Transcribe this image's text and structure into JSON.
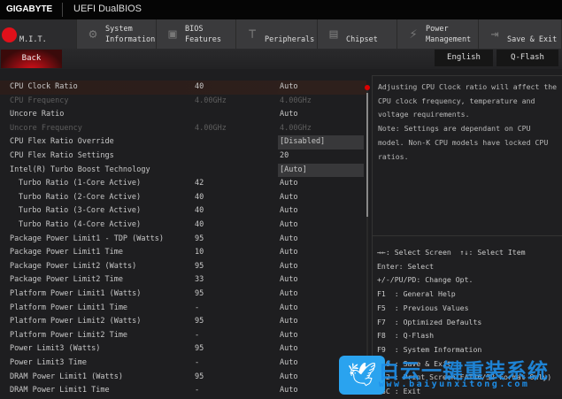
{
  "header": {
    "brand": "GIGABYTE",
    "title": "UEFI DualBIOS"
  },
  "tabs": [
    {
      "line1": "",
      "line2": "M.I.T.",
      "icon": "mit-dot-icon",
      "active": true
    },
    {
      "line1": "System",
      "line2": "Information",
      "icon": "gear-icon"
    },
    {
      "line1": "BIOS",
      "line2": "Features",
      "icon": "bios-chip-icon"
    },
    {
      "line1": "",
      "line2": "Peripherals",
      "icon": "peripherals-icon"
    },
    {
      "line1": "",
      "line2": "Chipset",
      "icon": "chipset-icon"
    },
    {
      "line1": "Power",
      "line2": "Management",
      "icon": "power-icon"
    },
    {
      "line1": "",
      "line2": "Save & Exit",
      "icon": "exit-icon"
    }
  ],
  "subbar": {
    "back": "Back",
    "language": "English",
    "qflash": "Q-Flash"
  },
  "settings": [
    {
      "name": "CPU Clock Ratio",
      "value": "40",
      "option": "Auto",
      "selected": true
    },
    {
      "name": "CPU Frequency",
      "value": "4.00GHz",
      "option": "4.00GHz",
      "disabled": true
    },
    {
      "name": "Uncore Ratio",
      "value": "",
      "option": "Auto"
    },
    {
      "name": "Uncore Frequency",
      "value": "4.00GHz",
      "option": "4.00GHz",
      "disabled": true
    },
    {
      "name": "CPU Flex Ratio Override",
      "value": "",
      "option": "[Disabled]",
      "box": true
    },
    {
      "name": "CPU Flex Ratio Settings",
      "value": "",
      "option": "20"
    },
    {
      "name": "Intel(R) Turbo Boost Technology",
      "value": "",
      "option": "[Auto]",
      "box": true
    },
    {
      "name": "Turbo Ratio (1-Core Active)",
      "value": "42",
      "option": "Auto",
      "indent": true
    },
    {
      "name": "Turbo Ratio (2-Core Active)",
      "value": "40",
      "option": "Auto",
      "indent": true
    },
    {
      "name": "Turbo Ratio (3-Core Active)",
      "value": "40",
      "option": "Auto",
      "indent": true
    },
    {
      "name": "Turbo Ratio (4-Core Active)",
      "value": "40",
      "option": "Auto",
      "indent": true
    },
    {
      "name": "Package Power Limit1 - TDP (Watts)",
      "value": "95",
      "option": "Auto"
    },
    {
      "name": "Package Power Limit1 Time",
      "value": "10",
      "option": "Auto"
    },
    {
      "name": "Package Power Limit2 (Watts)",
      "value": "95",
      "option": "Auto"
    },
    {
      "name": "Package Power Limit2 Time",
      "value": "33",
      "option": "Auto"
    },
    {
      "name": "Platform Power Limit1 (Watts)",
      "value": "95",
      "option": "Auto"
    },
    {
      "name": "Platform Power Limit1 Time",
      "value": "-",
      "option": "Auto"
    },
    {
      "name": "Platform Power Limit2 (Watts)",
      "value": "95",
      "option": "Auto"
    },
    {
      "name": "Platform Power Limit2 Time",
      "value": "-",
      "option": "Auto"
    },
    {
      "name": "Power Limit3 (Watts)",
      "value": "95",
      "option": "Auto"
    },
    {
      "name": "Power Limit3 Time",
      "value": "-",
      "option": "Auto"
    },
    {
      "name": "DRAM Power Limit1 (Watts)",
      "value": "95",
      "option": "Auto"
    },
    {
      "name": "DRAM Power Limit1 Time",
      "value": "-",
      "option": "Auto"
    }
  ],
  "description": "Adjusting CPU Clock ratio will affect the CPU clock frequency, temperature and voltage requirements.\nNote: Settings are dependant  on  CPU model. Non-K CPU models have locked CPU ratios.",
  "help": [
    "→←: Select Screen  ↑↓: Select Item",
    "Enter: Select",
    "+/-/PU/PD: Change Opt.",
    "F1  : General Help",
    "F5  : Previous Values",
    "F7  : Optimized Defaults",
    "F8  : Q-Flash",
    "F9  : System Information",
    "F10 : Save & Exit",
    "F12 : Print Screen(FAT16/32 Format Only)",
    "ESC : Exit"
  ],
  "watermark": {
    "text": "白云一键重装系统",
    "url": "www.baiyunxitong.com",
    "icon": "twitter-bird-icon"
  },
  "colors": {
    "accent": "#e0101a",
    "watermark": "#1e8ee8"
  }
}
